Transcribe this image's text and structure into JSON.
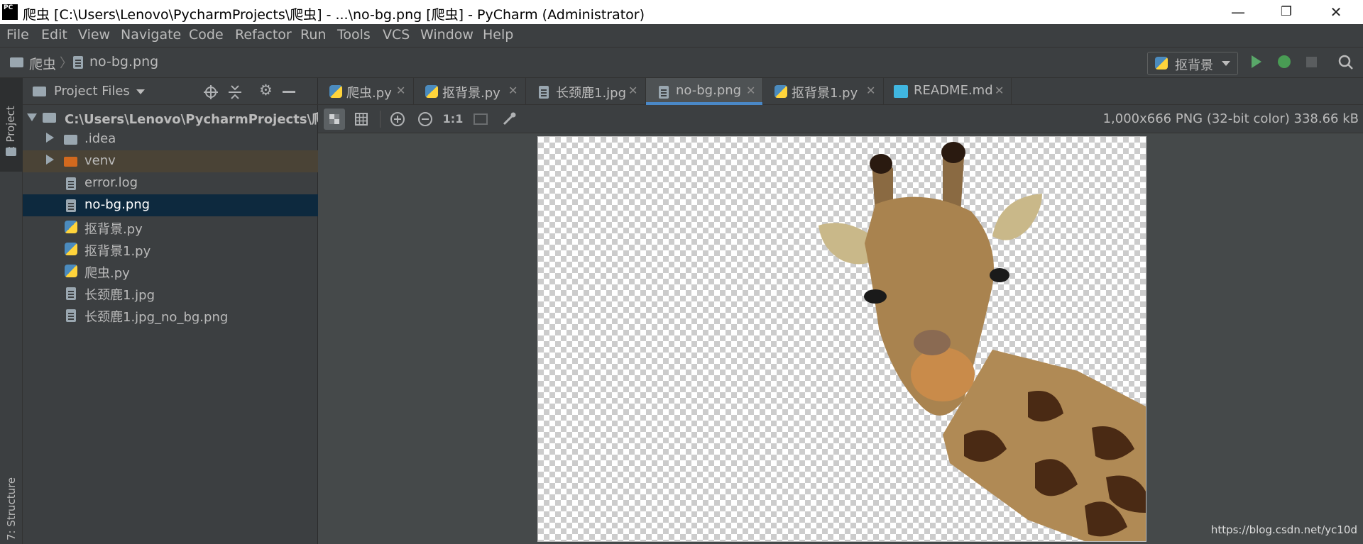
{
  "window": {
    "app_icon_text": "PC",
    "title": "爬虫 [C:\\Users\\Lenovo\\PycharmProjects\\爬虫] - ...\\no-bg.png [爬虫] - PyCharm (Administrator)",
    "minimize": "—",
    "restore": "❐",
    "close": "✕"
  },
  "menu": {
    "file": "File",
    "edit": "Edit",
    "view": "View",
    "navigate": "Navigate",
    "code": "Code",
    "refactor": "Refactor",
    "run": "Run",
    "tools": "Tools",
    "vcs": "VCS",
    "window": "Window",
    "help": "Help"
  },
  "breadcrumb": {
    "project": "爬虫",
    "file": "no-bg.png"
  },
  "run_config": {
    "name": "抠背景"
  },
  "side_strip": {
    "project_tab": "1: Project",
    "structure_tab": "7: Structure"
  },
  "project_panel": {
    "header": "Project Files",
    "root": "C:\\Users\\Lenovo\\PycharmProjects\\爬虫",
    "items": [
      {
        "label": "idea_folder",
        "name": ".idea"
      },
      {
        "label": "venv_folder",
        "name": "venv"
      },
      {
        "label": "file",
        "name": "error.log"
      },
      {
        "label": "file",
        "name": "no-bg.png"
      },
      {
        "label": "py",
        "name": "抠背景.py"
      },
      {
        "label": "py",
        "name": "抠背景1.py"
      },
      {
        "label": "py",
        "name": "爬虫.py"
      },
      {
        "label": "file",
        "name": "长颈鹿1.jpg"
      },
      {
        "label": "file",
        "name": "长颈鹿1.jpg_no_bg.png"
      }
    ]
  },
  "tabs": [
    {
      "label": "爬虫.py",
      "type": "py"
    },
    {
      "label": "抠背景.py",
      "type": "py"
    },
    {
      "label": "长颈鹿1.jpg",
      "type": "image"
    },
    {
      "label": "no-bg.png",
      "type": "image",
      "active": true
    },
    {
      "label": "抠背景1.py",
      "type": "py"
    },
    {
      "label": "README.md",
      "type": "md"
    }
  ],
  "image_toolbar": {
    "zoom_actual": "1:1",
    "image_info": "1,000x666 PNG (32-bit color) 338.66 kB"
  },
  "watermark": "https://blog.csdn.net/yc10d",
  "colors": {
    "accent_tab": "#4a88c7",
    "selected_row": "#0d293e",
    "venv_row": "#4a4336",
    "run_green": "#59a869",
    "debug_green": "#499c54"
  }
}
